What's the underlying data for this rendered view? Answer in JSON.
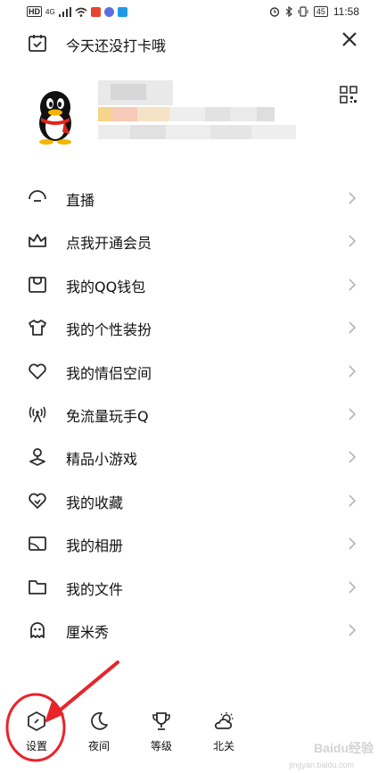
{
  "status": {
    "left_items": [
      "HD",
      "4G"
    ],
    "time": "11:58",
    "battery": "45"
  },
  "checkin": {
    "text": "今天还没打卡哦"
  },
  "menu": [
    {
      "label": "直播",
      "icon": "live-icon"
    },
    {
      "label": "点我开通会员",
      "icon": "crown-icon"
    },
    {
      "label": "我的QQ钱包",
      "icon": "wallet-icon"
    },
    {
      "label": "我的个性装扮",
      "icon": "tshirt-icon"
    },
    {
      "label": "我的情侣空间",
      "icon": "heart-icon"
    },
    {
      "label": "免流量玩手Q",
      "icon": "antenna-icon"
    },
    {
      "label": "精品小游戏",
      "icon": "joystick-icon"
    },
    {
      "label": "我的收藏",
      "icon": "favorite-heart-icon"
    },
    {
      "label": "我的相册",
      "icon": "album-icon"
    },
    {
      "label": "我的文件",
      "icon": "folder-icon"
    },
    {
      "label": "厘米秀",
      "icon": "ghost-icon"
    }
  ],
  "bottom": [
    {
      "label": "设置",
      "icon": "settings-hexagon-icon"
    },
    {
      "label": "夜间",
      "icon": "moon-icon"
    },
    {
      "label": "等级",
      "icon": "trophy-icon"
    },
    {
      "label": "北关",
      "icon": "weather-icon"
    }
  ],
  "watermark": {
    "text": "Baidu经验",
    "sub": "jingyan.baidu.com"
  },
  "colors": {
    "annotation": "#e8242a",
    "icon": "#2b2b2b",
    "chevron": "#b5b5b5"
  }
}
